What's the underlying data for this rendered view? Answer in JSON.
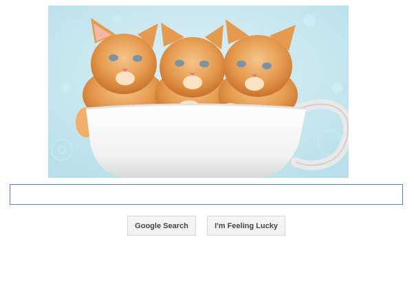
{
  "doodle": {
    "alt_subject": "kittens-in-teacup-image"
  },
  "search": {
    "value": "",
    "placeholder": ""
  },
  "buttons": {
    "search_label": "Google Search",
    "lucky_label": "I'm Feeling Lucky"
  },
  "colors": {
    "search_border": "#4d7fd8",
    "button_bg": "#f2f2f2",
    "button_text": "#444444"
  }
}
